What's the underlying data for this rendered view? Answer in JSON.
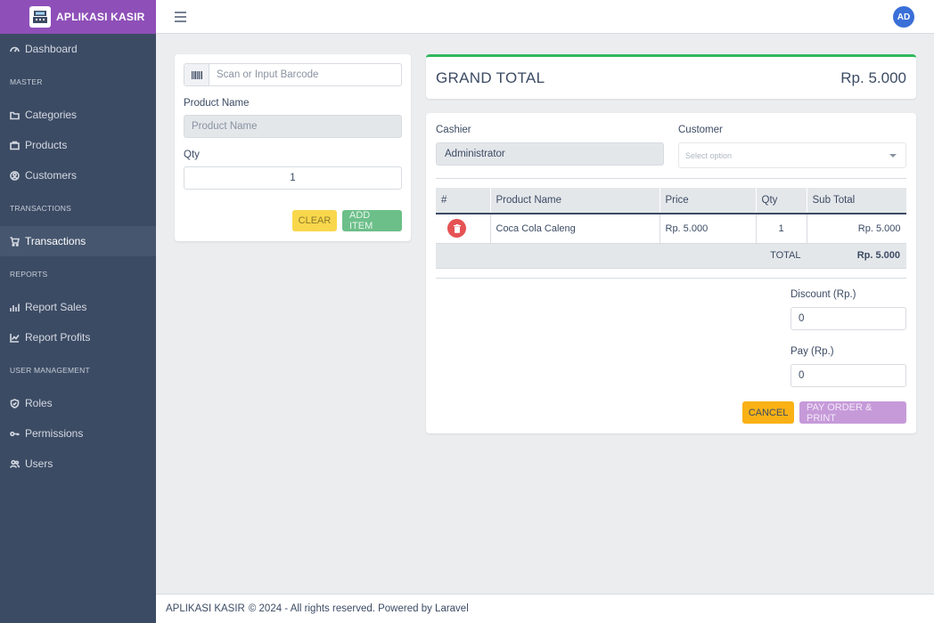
{
  "brand": {
    "name": "APLIKASI KASIR"
  },
  "sidebar": {
    "items": [
      {
        "type": "item",
        "label": "Dashboard",
        "icon": "dashboard-icon"
      },
      {
        "type": "title",
        "label": "MASTER"
      },
      {
        "type": "item",
        "label": "Categories",
        "icon": "folder-icon"
      },
      {
        "type": "item",
        "label": "Products",
        "icon": "briefcase-icon"
      },
      {
        "type": "item",
        "label": "Customers",
        "icon": "user-circle-icon"
      },
      {
        "type": "title",
        "label": "TRANSACTIONS"
      },
      {
        "type": "item",
        "label": "Transactions",
        "icon": "cart-icon",
        "active": true
      },
      {
        "type": "title",
        "label": "REPORTS"
      },
      {
        "type": "item",
        "label": "Report Sales",
        "icon": "bar-chart-icon"
      },
      {
        "type": "item",
        "label": "Report Profits",
        "icon": "line-chart-icon"
      },
      {
        "type": "title",
        "label": "USER MANAGEMENT"
      },
      {
        "type": "item",
        "label": "Roles",
        "icon": "shield-icon"
      },
      {
        "type": "item",
        "label": "Permissions",
        "icon": "key-icon"
      },
      {
        "type": "item",
        "label": "Users",
        "icon": "users-icon"
      }
    ]
  },
  "header": {
    "avatar_initials": "AD"
  },
  "product_form": {
    "barcode_placeholder": "Scan or Input Barcode",
    "product_name_label": "Product Name",
    "product_name_placeholder": "Product Name",
    "qty_label": "Qty",
    "qty_value": "1",
    "clear_label": "CLEAR",
    "add_label": "ADD ITEM"
  },
  "grand_total": {
    "label": "GRAND TOTAL",
    "value": "Rp. 5.000"
  },
  "order": {
    "cashier_label": "Cashier",
    "cashier_value": "Administrator",
    "customer_label": "Customer",
    "customer_placeholder": "Select option",
    "columns": [
      "#",
      "Product Name",
      "Price",
      "Qty",
      "Sub Total"
    ],
    "rows": [
      {
        "product": "Coca Cola Caleng",
        "price": "Rp. 5.000",
        "qty": "1",
        "subtotal": "Rp. 5.000"
      }
    ],
    "total_label": "TOTAL",
    "total_value": "Rp. 5.000",
    "discount_label": "Discount (Rp.)",
    "discount_value": "0",
    "pay_label": "Pay (Rp.)",
    "pay_value": "0",
    "cancel_label": "CANCEL",
    "pay_button_label": "PAY ORDER & PRINT"
  },
  "footer": {
    "brand": "APLIKASI KASIR",
    "text": "© 2024 - All rights reserved. Powered by Laravel"
  },
  "colors": {
    "brand": "#8e4fb8",
    "sidebar": "#3c4b64",
    "success": "#2eb85c",
    "danger": "#e55353",
    "warning": "#f9b115"
  }
}
